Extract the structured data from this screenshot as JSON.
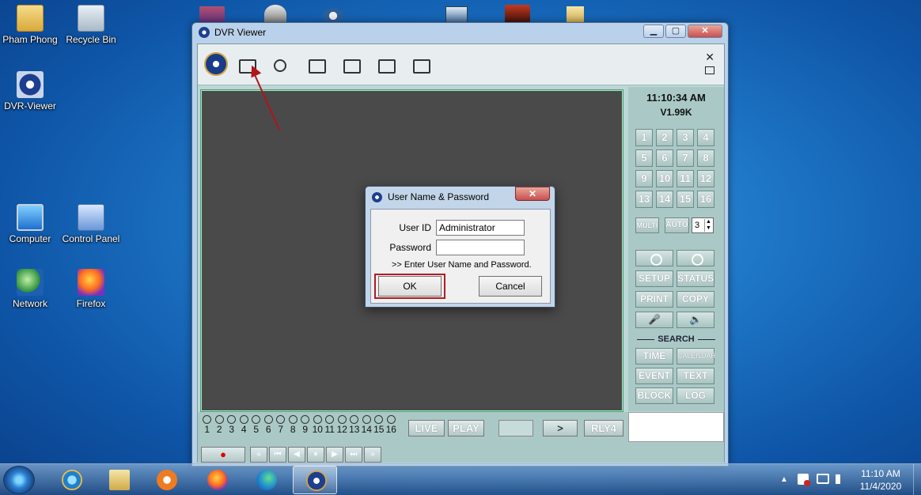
{
  "desktop_icons": [
    {
      "label": "Pham Phong",
      "icon": "folder-icon"
    },
    {
      "label": "Recycle Bin",
      "icon": "recycle-bin-icon"
    },
    {
      "label": "DVR-Viewer",
      "icon": "dvr-viewer-icon"
    },
    {
      "label": "Computer",
      "icon": "computer-icon"
    },
    {
      "label": "Control Panel",
      "icon": "control-panel-icon"
    },
    {
      "label": "Network",
      "icon": "network-icon"
    },
    {
      "label": "Firefox",
      "icon": "firefox-icon"
    }
  ],
  "window": {
    "title": "DVR Viewer",
    "controls": {
      "minimize": "▁",
      "maximize": "▢",
      "close": "✕"
    }
  },
  "toolbar": {
    "buttons": [
      "connect-icon",
      "search-icon",
      "device-icon",
      "files-icon",
      "layout-icon",
      "check-icon"
    ],
    "close": "✕"
  },
  "side_panel": {
    "time": "11:10:34 AM",
    "version": "V1.99K",
    "channels": [
      "1",
      "2",
      "3",
      "4",
      "5",
      "6",
      "7",
      "8",
      "9",
      "10",
      "11",
      "12",
      "13",
      "14",
      "15",
      "16"
    ],
    "multi": "MULTI",
    "auto": "AUTO",
    "auto_value": "3",
    "setup": "SETUP",
    "status": "STATUS",
    "print": "PRINT",
    "copy": "COPY",
    "search_label": "SEARCH",
    "time_btn": "TIME",
    "calendar": "CALENDAR",
    "event": "EVENT",
    "text": "TEXT",
    "block": "BLOCK",
    "log": "LOG"
  },
  "bottom_bar": {
    "channel_numbers": [
      "1",
      "2",
      "3",
      "4",
      "5",
      "6",
      "7",
      "8",
      "9",
      "10",
      "11",
      "12",
      "13",
      "14",
      "15",
      "16"
    ],
    "live": "LIVE",
    "play": "PLAY",
    "next": ">",
    "relay": "RLY4",
    "playback": {
      "record": "●",
      "fast_back": "«",
      "step_back": "⏮",
      "back": "◀",
      "pause": "⏸",
      "forward": "▶",
      "step_fwd": "⏭",
      "fast_fwd": "»"
    }
  },
  "dialog": {
    "title": "User Name & Password",
    "close": "✕",
    "user_id_label": "User ID",
    "user_id_value": "Administrator",
    "password_label": "Password",
    "password_value": "",
    "hint": ">> Enter User Name and Password.",
    "ok": "OK",
    "cancel": "Cancel"
  },
  "taskbar": {
    "apps": [
      "windows-start-icon",
      "internet-explorer-icon",
      "file-explorer-icon",
      "media-player-icon",
      "firefox-icon",
      "edge-icon",
      "dvr-viewer-icon"
    ],
    "time": "11:10 AM",
    "date": "11/4/2020",
    "tray_arrow": "▲"
  },
  "colors": {
    "highlight": "#b01c24",
    "annotation_arrow": "#b0141c"
  }
}
